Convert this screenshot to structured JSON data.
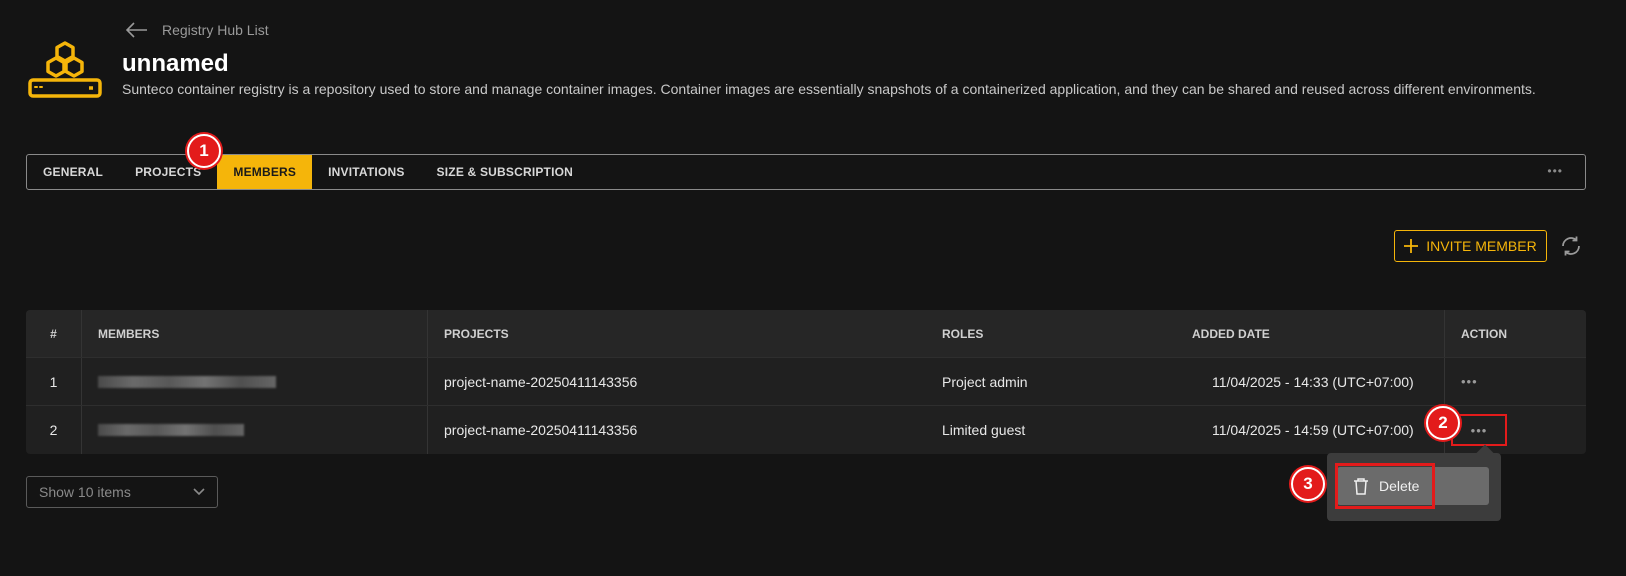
{
  "header": {
    "back_label": "Registry Hub List",
    "title": "unnamed",
    "description": "Sunteco container registry is a repository used to store and manage container images. Container images are essentially snapshots of a containerized application, and they can be shared and reused across different environments."
  },
  "tabs": [
    {
      "label": "GENERAL",
      "active": false
    },
    {
      "label": "PROJECTS",
      "active": false
    },
    {
      "label": "MEMBERS",
      "active": true
    },
    {
      "label": "INVITATIONS",
      "active": false
    },
    {
      "label": "SIZE & SUBSCRIPTION",
      "active": false
    }
  ],
  "tabs_more": "•••",
  "markers": [
    "1",
    "2",
    "3"
  ],
  "toolbar": {
    "invite_label": "INVITE MEMBER"
  },
  "table": {
    "headers": [
      "#",
      "MEMBERS",
      "PROJECTS",
      "ROLES",
      "ADDED DATE",
      "ACTION"
    ],
    "rows": [
      {
        "index": "1",
        "project": "project-name-20250411143356",
        "role": "Project admin",
        "added": "11/04/2025 - 14:33 (UTC+07:00)",
        "action": "•••"
      },
      {
        "index": "2",
        "project": "project-name-20250411143356",
        "role": "Limited guest",
        "added": "11/04/2025 - 14:59 (UTC+07:00)",
        "action": "•••"
      }
    ]
  },
  "pagination": {
    "page_size_label": "Show 10 items"
  },
  "popover": {
    "delete_label": "Delete"
  },
  "colors": {
    "accent": "#f5b50a",
    "highlight": "#e31b1b",
    "background": "#141414"
  }
}
